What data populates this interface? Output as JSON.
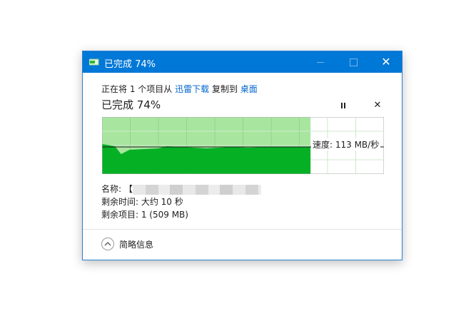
{
  "window": {
    "title": "已完成 74%",
    "minimize_label": "",
    "close_symbol": "✕"
  },
  "copy": {
    "prefix": "正在将 1 个项目从",
    "source": "迅雷下载",
    "middle": "复制到",
    "destination": "桌面",
    "heading": "已完成 74%",
    "pause_symbol": "⏸",
    "cancel_symbol": "✕"
  },
  "speed": {
    "label": "速度: 113 MB/秒",
    "percent_complete": 74
  },
  "details": {
    "name_label": "名称: 【",
    "time_label": "剩余时间: 大约 10 秒",
    "items_label": "剩余项目: 1 (509 MB)"
  },
  "footer": {
    "label": "简略信息"
  },
  "colors": {
    "titlebar": "#0078d7",
    "graph_filled": "#06b025",
    "graph_background": "#a8e6a0",
    "link": "#0066cc"
  },
  "icons": {
    "app": "file-copy-icon",
    "pause": "pause-icon",
    "cancel": "close-icon",
    "collapse": "chevron-up-icon"
  }
}
